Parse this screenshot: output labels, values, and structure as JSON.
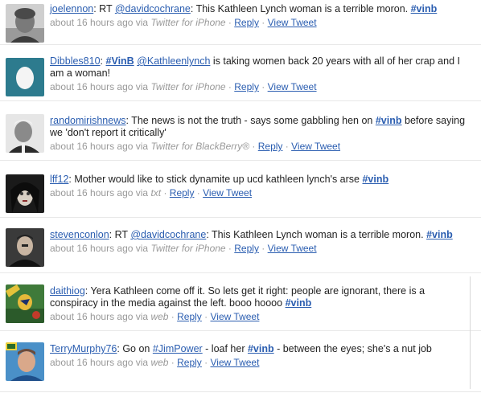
{
  "tweets": [
    {
      "user": "joelennon",
      "segments": [
        ": RT ",
        "@davidcochrane",
        ": This Kathleen Lynch woman is a terrible moron. ",
        "#vinb"
      ],
      "meta_time": "about 16 hours ago via ",
      "meta_source": "Twitter for iPhone",
      "reply": "Reply",
      "view": "View Tweet"
    },
    {
      "user": "Dibbles810",
      "segments": [
        ": ",
        "#VinB",
        " ",
        "@Kathleenlynch",
        " is taking women back 20 years with all of her crap and I am a woman!"
      ],
      "meta_time": "about 16 hours ago via ",
      "meta_source": "Twitter for iPhone",
      "reply": "Reply",
      "view": "View Tweet"
    },
    {
      "user": "randomirishnews",
      "segments": [
        ": The news is not the truth - says some gabbling hen on ",
        "#vinb",
        " before saying we 'don't report it critically'"
      ],
      "meta_time": "about 16 hours ago via ",
      "meta_source": "Twitter for BlackBerry®",
      "reply": "Reply",
      "view": "View Tweet"
    },
    {
      "user": "lff12",
      "segments": [
        ": Mother would like to stick dynamite up ucd kathleen lynch's arse ",
        "#vinb"
      ],
      "meta_time": "about 16 hours ago via ",
      "meta_source": "txt",
      "reply": "Reply",
      "view": "View Tweet"
    },
    {
      "user": "stevenconlon",
      "segments": [
        ": RT ",
        "@davidcochrane",
        ": This Kathleen Lynch woman is a terrible moron. ",
        "#vinb"
      ],
      "meta_time": "about 16 hours ago via ",
      "meta_source": "Twitter for iPhone",
      "reply": "Reply",
      "view": "View Tweet"
    },
    {
      "user": "daithiog",
      "segments": [
        ": Yera Kathleen come off it. So lets get it right: people are ignorant, there is a conspiracy in the media against the left. booo hoooo ",
        "#vinb"
      ],
      "meta_time": "about 16 hours ago via ",
      "meta_source": "web",
      "reply": "Reply",
      "view": "View Tweet"
    },
    {
      "user": "TerryMurphy76",
      "segments": [
        ": Go on ",
        "#JimPower",
        " - loaf her ",
        "#vinb",
        " - between the eyes; she's a nut job"
      ],
      "meta_time": "about 16 hours ago via ",
      "meta_source": "web",
      "reply": "Reply",
      "view": "View Tweet"
    }
  ],
  "separator": " · "
}
